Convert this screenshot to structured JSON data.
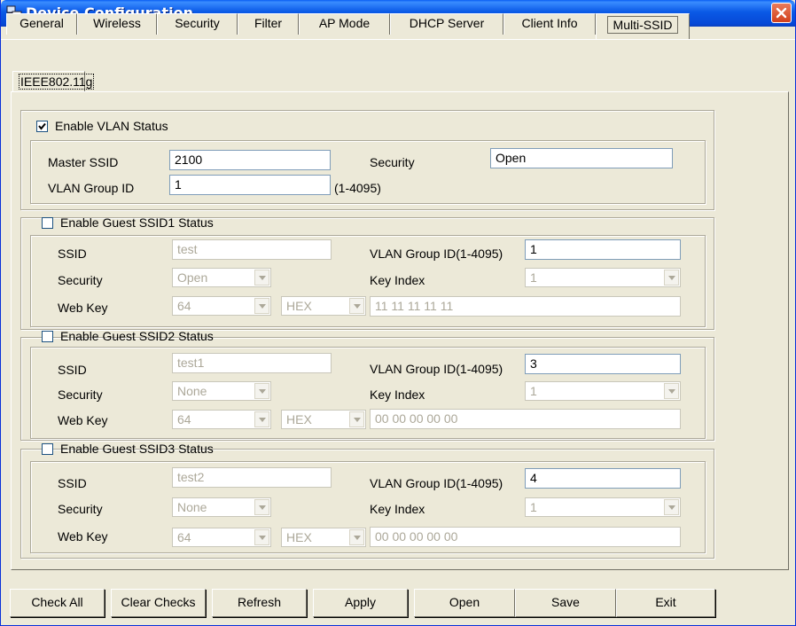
{
  "window": {
    "title": "Device Configuration"
  },
  "tabs": [
    "General",
    "Wireless",
    "Security",
    "Filter",
    "AP Mode",
    "DHCP Server",
    "Client Info",
    "Multi-SSID"
  ],
  "subtab": "IEEE802.11g",
  "vlan": {
    "enable_label": "Enable VLAN Status",
    "enabled": true,
    "master_ssid_label": "Master SSID",
    "master_ssid": "2100",
    "security_label": "Security",
    "security": "Open",
    "group_id_label": "VLAN Group ID",
    "group_id": "1",
    "range": "(1-4095)"
  },
  "labels": {
    "ssid": "SSID",
    "security": "Security",
    "web_key": "Web Key",
    "vlan_group": "VLAN Group ID(1-4095)",
    "key_index": "Key Index"
  },
  "guests": [
    {
      "enable_label": "Enable Guest SSID1 Status",
      "enabled": false,
      "ssid": "test",
      "vlan": "1",
      "security": "Open",
      "key_index": "1",
      "key_len": "64",
      "key_fmt": "HEX",
      "key": "11 11 11 11 11"
    },
    {
      "enable_label": "Enable Guest SSID2 Status",
      "enabled": false,
      "ssid": "test1",
      "vlan": "3",
      "security": "None",
      "key_index": "1",
      "key_len": "64",
      "key_fmt": "HEX",
      "key": "00 00 00 00 00"
    },
    {
      "enable_label": "Enable Guest SSID3 Status",
      "enabled": false,
      "ssid": "test2",
      "vlan": "4",
      "security": "None",
      "key_index": "1",
      "key_len": "64",
      "key_fmt": "HEX",
      "key": "00 00 00 00 00"
    }
  ],
  "buttons": [
    "Check All",
    "Clear Checks",
    "Refresh",
    "Apply",
    "Open",
    "Save",
    "Exit"
  ]
}
